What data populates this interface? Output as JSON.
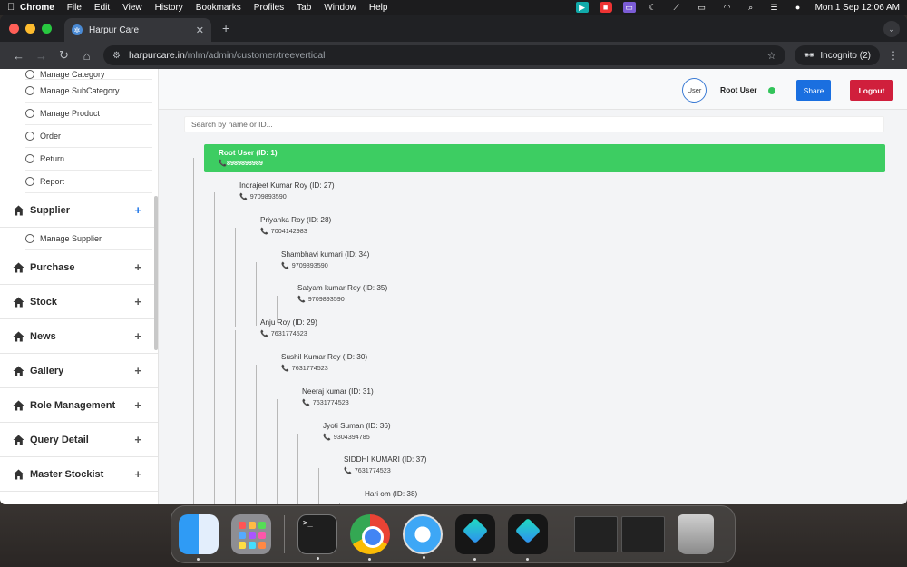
{
  "menubar": {
    "app": "Chrome",
    "items": [
      "File",
      "Edit",
      "View",
      "History",
      "Bookmarks",
      "Profiles",
      "Tab",
      "Window",
      "Help"
    ],
    "datetime": "Mon 1 Sep  12:06 AM"
  },
  "browser": {
    "tab_title": "Harpur Care",
    "url_host": "harpurcare.in",
    "url_path": "/mlm/admin/customer/treevertical",
    "incognito_label": "Incognito (2)"
  },
  "sidebar": {
    "top_sub_items": [
      "Manage Category",
      "Manage SubCategory",
      "Manage Product",
      "Order",
      "Return",
      "Report"
    ],
    "supplier": {
      "label": "Supplier",
      "sub_items": [
        "Manage Supplier"
      ]
    },
    "sections": [
      "Purchase",
      "Stock",
      "News",
      "Gallery",
      "Role Management",
      "Query Detail",
      "Master Stockist"
    ]
  },
  "header": {
    "avatar_alt": "User",
    "user_name": "Root User",
    "share_label": "Share",
    "logout_label": "Logout"
  },
  "search": {
    "placeholder": "Search by name or ID..."
  },
  "tree": {
    "root": {
      "name": "Root User (ID: 1)",
      "phone": "8989898989"
    },
    "nodes": [
      {
        "name": "Indrajeet Kumar Roy (ID: 27)",
        "phone": "9709893590"
      },
      {
        "name": "Priyanka Roy (ID: 28)",
        "phone": "7004142983"
      },
      {
        "name": "Shambhavi kumari (ID: 34)",
        "phone": "9709893590"
      },
      {
        "name": "Satyam kumar Roy (ID: 35)",
        "phone": "9709893590"
      },
      {
        "name": "Anju Roy (ID: 29)",
        "phone": "7631774523"
      },
      {
        "name": "Sushil Kumar Roy (ID: 30)",
        "phone": "7631774523"
      },
      {
        "name": "Neeraj kumar (ID: 31)",
        "phone": "7631774523"
      },
      {
        "name": "Jyoti Suman (ID: 36)",
        "phone": "9304394785"
      },
      {
        "name": "SIDDHI KUMARI (ID: 37)",
        "phone": "7631774523"
      },
      {
        "name": "Hari om (ID: 38)",
        "phone": ""
      }
    ]
  },
  "colors": {
    "root_node": "#3dcd62",
    "share_button": "#1a6fe0",
    "logout_button": "#d01f3c",
    "online_dot": "#33c45a"
  }
}
